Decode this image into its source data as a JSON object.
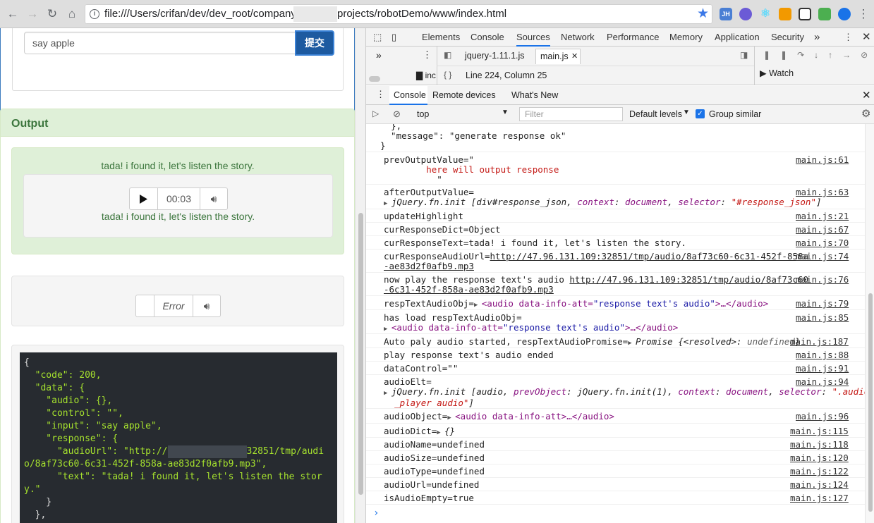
{
  "browser": {
    "url_prefix": "file:///Users/crifan/dev/dev_root/company/",
    "url_suffix": "projects/robotDemo/www/index.html",
    "extension_labels": [
      "JH"
    ]
  },
  "page": {
    "input_value": "say apple",
    "submit_label": "提交",
    "output_title": "Output",
    "response_text": "tada! i found it, let's listen the story.",
    "player_time": "00:03",
    "player_error": "Error",
    "json_lines": [
      "{",
      "  \"code\": 200,",
      "  \"data\": {",
      "    \"audio\": {},",
      "    \"control\": \"\",",
      "    \"input\": \"say apple\",",
      "    \"response\": {",
      "      \"audioUrl\": \"http://",
      "32851/tmp/audi",
      "o/8af73c60-6c31-452f-858a-ae83d2f0afb9.mp3\",",
      "      \"text\": \"tada! i found it, let's listen the stor",
      "y.\"",
      "    }",
      "  },"
    ]
  },
  "devtools": {
    "tabs": [
      "Elements",
      "Console",
      "Sources",
      "Network",
      "Performance",
      "Memory",
      "Application",
      "Security"
    ],
    "more_tabs": "»",
    "file_tabs": [
      "jquery-1.11.1.js",
      "main.js"
    ],
    "navigator_item": "inc",
    "cursor_status": "Line 224, Column 25",
    "watch_label": "Watch",
    "drawer_tabs": [
      "Console",
      "Remote devices",
      "What's New"
    ],
    "context": "top",
    "filter_placeholder": "Filter",
    "levels": "Default levels",
    "group_similar": "Group similar",
    "console_lines": {
      "l0a": "  },",
      "l0b": "  \"message\": \"generate response ok\"",
      "l0c": "}",
      "l1a": "prevOutputValue=\"",
      "l1b": "here will output response",
      "l1c": "\"",
      "l2a": "afterOutputValue=",
      "l2b_pre": "jQuery.fn.init [div#response_json, ",
      "l2b_ctx": "context",
      "l2b_doc": "document",
      "l2b_sel": "selector",
      "l2b_val": "\"#response_json\"",
      "l3": "updateHighlight",
      "l4": "curResponseDict=Object",
      "l5": "curResponseText=tada! i found it, let's listen the story.",
      "l6a": "curResponseAudioUrl=",
      "l6b": "http://47.96.131.109:32851/tmp/audio/8af73c60-6c31-452f-858a",
      "l6c": "-ae83d2f0afb9.mp3",
      "l7a": "now play the response text's audio ",
      "l7b": "http://47.96.131.109:32851/tmp/audio/8af73c60",
      "l7c": "-6c31-452f-858a-ae83d2f0afb9.mp3",
      "l8a": "respTextAudioObj=",
      "l8b": "<audio data-info-att=",
      "l8c": "\"response text's audio\"",
      "l8d": ">…</audio>",
      "l9a": "has load respTextAudioObj=",
      "l9b": "<audio data-info-att=",
      "l9c": "\"response text's audio\"",
      "l9d": ">…</audio>",
      "l10a": "Auto paly audio started, respTextAudioPromise=",
      "l10b": "Promise {<resolved>: ",
      "l10c": "undefined",
      "l10d": "}",
      "l11": "play response text's audio ended",
      "l12": "dataControl=\"\"",
      "l13a": "audioElt=",
      "l13b": "jQuery.fn.init [audio, ",
      "l13c": "prevObject",
      "l13d": ": jQuery.fn.init(1), ",
      "l13e": "context",
      "l13f": ": ",
      "l13g": "document",
      "l13h": ", ",
      "l13i": "selector",
      "l13j": ": ",
      "l13k": "\".audio",
      "l13l": "_player audio\"",
      "l13m": "]",
      "l14a": "audioObject=",
      "l14b": "<audio data-info-att>…</audio>",
      "l15a": "audioDict=",
      "l15b": "{}",
      "l16": "audioName=undefined",
      "l17": "audioSize=undefined",
      "l18": "audioType=undefined",
      "l19": "audioUrl=undefined",
      "l20": "isAudioEmpty=true"
    },
    "sources": {
      "s1": "main.js:61",
      "s2": "main.js:63",
      "s3": "main.js:21",
      "s4": "main.js:67",
      "s5": "main.js:70",
      "s6": "main.js:74",
      "s7": "main.js:76",
      "s8": "main.js:79",
      "s9": "main.js:85",
      "s10": "main.js:187",
      "s11": "main.js:88",
      "s12": "main.js:91",
      "s13": "main.js:94",
      "s14": "main.js:96",
      "s15": "main.js:115",
      "s16": "main.js:118",
      "s17": "main.js:120",
      "s18": "main.js:122",
      "s19": "main.js:124",
      "s20": "main.js:127"
    },
    "prompt": "›"
  },
  "colors": {
    "accent": "#1a73e8",
    "submit_bg": "#1d5aa0",
    "success_bg": "#dff0d8",
    "success_text": "#3c763d",
    "code_bg": "#272b30"
  }
}
